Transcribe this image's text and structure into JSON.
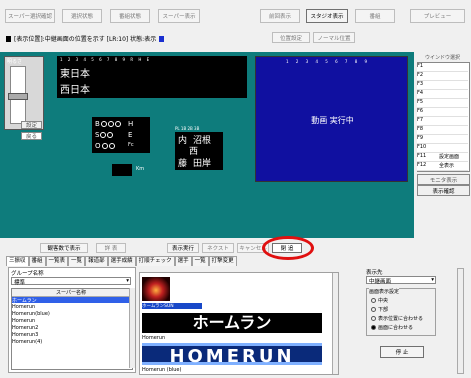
{
  "toolbar": {
    "buttons": [
      "スーパー選択確認",
      "選択状態",
      "番組状態",
      "スーパー表示",
      "前回表示",
      "スタジオ表示",
      "番組",
      "プレビュー"
    ],
    "status_text": "[表示位置]:中継画面の位置を示す [LR:10] 状態:表示",
    "right_buttons": [
      "位置設定",
      "ノーマル位置"
    ]
  },
  "scoreboard": {
    "inning_header": "1 2 3 4 5 6 7 8 9 R H E",
    "team_top": "東日本",
    "team_bottom": "西日本",
    "ball_label": "B",
    "strike_label": "S",
    "out_label": "O",
    "hit_label": "H",
    "error_label": "E",
    "fc_label": "Fc",
    "mini_label": "Km",
    "fielding_header": "PL 1B 2B 3B",
    "fielders": [
      "内",
      "沼根",
      "西",
      "藤",
      "田岸"
    ],
    "left_panel_label": "明るさ",
    "left_btn_1": "設定",
    "left_btn_2": "戻る"
  },
  "video": {
    "label": "動画 実行中",
    "header": "1 2 3 4 5 6 7 8 9"
  },
  "right_list": {
    "title": "ウインドウ選択",
    "items": [
      "F1",
      "F2",
      "F3",
      "F4",
      "F5",
      "F6",
      "F7",
      "F8",
      "F9",
      "F10",
      "F11",
      "F12"
    ],
    "item_notes": [
      "",
      "",
      "",
      "",
      "",
      "",
      "",
      "",
      "",
      "",
      "設定画面",
      "全表示"
    ],
    "buttons": [
      "モニタ表示",
      "表示確認"
    ]
  },
  "bottom": {
    "action_buttons": [
      "観客数で表示",
      "詳 表",
      "表示実行",
      "ネクスト",
      "キャンセル"
    ],
    "highlight_button": "閉 追",
    "tabs": [
      "三振収",
      "番組",
      "一覧表",
      "一覧",
      "報道部",
      "選手成績",
      "打順チェック",
      "選手",
      "一覧",
      "打撃変更"
    ],
    "group_label": "グループ名称",
    "group_value": "標準",
    "list_header": "スーパー名称",
    "list_items": [
      "ホームラン",
      "Homerun",
      "Homerun(blue)",
      "Homerun",
      "Homerun2",
      "Homerun3",
      "Homerun(4)"
    ],
    "selected_index": 0,
    "preview_small_caption": "ホームランSUN",
    "preview_jp_text": "ホームラン",
    "preview_caption_1": "Homerun",
    "preview_en_text": "HOMERUN",
    "preview_caption_2": "Homerun (blue)",
    "right_label": "表示先",
    "right_select": "中継画面",
    "mode_title": "画面表示設定",
    "radio_options": [
      "中央",
      "下部",
      "表示位置に合わせる",
      "画面に合わせる"
    ],
    "radio_selected": 3,
    "stop_button": "停 止"
  }
}
